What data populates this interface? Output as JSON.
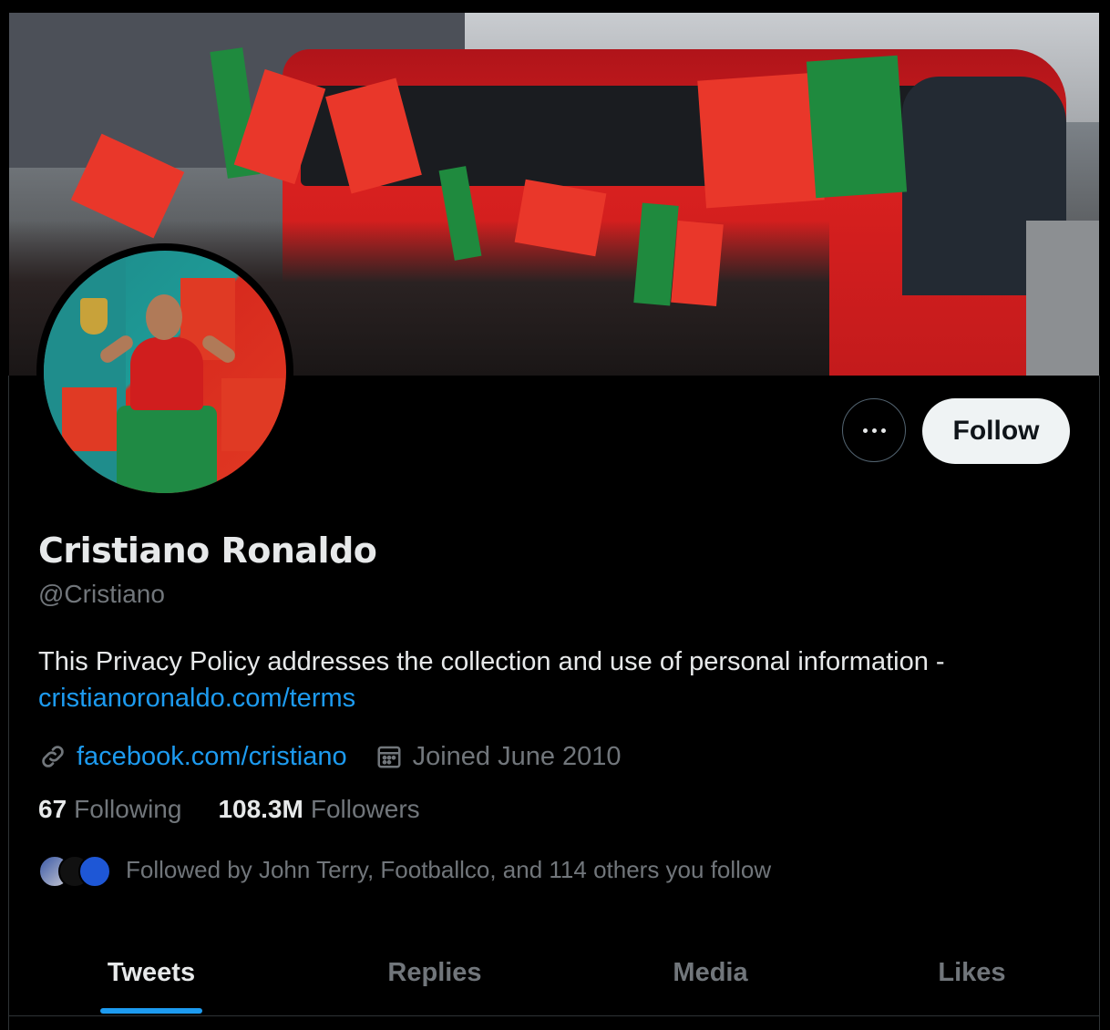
{
  "profile": {
    "name": "Cristiano Ronaldo",
    "handle": "@Cristiano",
    "bio_text": "This Privacy Policy addresses the collection and use of personal information - ",
    "bio_link": "cristianoronaldo.com/terms",
    "website": "facebook.com/cristiano",
    "joined": "Joined June 2010"
  },
  "actions": {
    "more_icon": "more-horizontal-icon",
    "follow_label": "Follow"
  },
  "stats": {
    "following_count": "67",
    "following_label": "Following",
    "followers_count": "108.3M",
    "followers_label": "Followers"
  },
  "followed_by": "Followed by John Terry, Footballco, and 114 others you follow",
  "tabs": [
    {
      "label": "Tweets",
      "active": true
    },
    {
      "label": "Replies",
      "active": false
    },
    {
      "label": "Media",
      "active": false
    },
    {
      "label": "Likes",
      "active": false
    }
  ],
  "colors": {
    "accent": "#1d9bf0",
    "background": "#000000",
    "text_primary": "#e7e9ea",
    "text_secondary": "#71767b",
    "follow_button_bg": "#eff3f4"
  },
  "icons": {
    "link": "link-icon",
    "calendar": "calendar-icon"
  }
}
